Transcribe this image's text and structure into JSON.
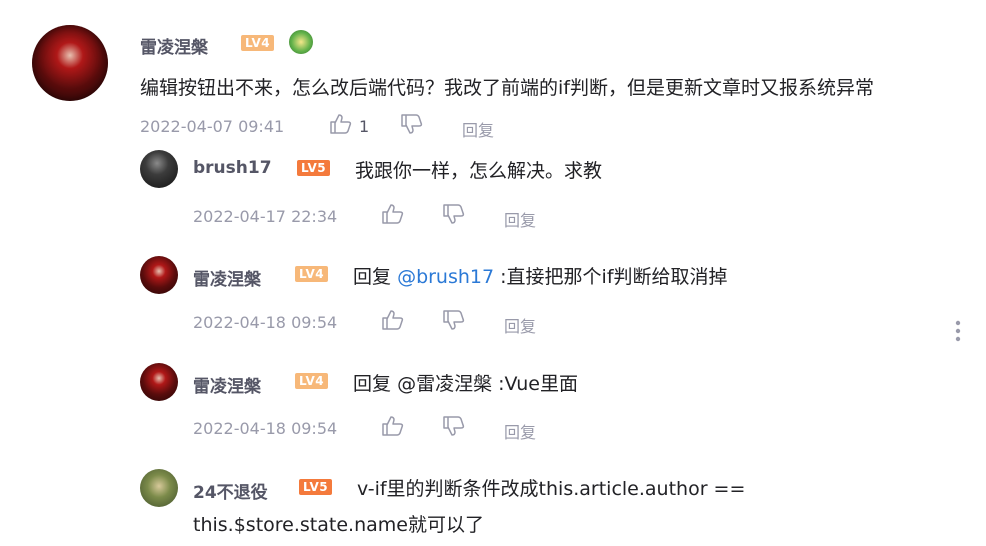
{
  "comments": [
    {
      "user": "雷凌涅槃",
      "level": "LV4",
      "text": "编辑按钮出不来，怎么改后端代码？我改了前端的if判断，但是更新文章时又报系统异常",
      "time": "2022-04-07 09:41",
      "likes": "1",
      "reply_label": "回复"
    }
  ],
  "replies": [
    {
      "user": "brush17",
      "level": "LV5",
      "text": "我跟你一样，怎么解决。求教",
      "time": "2022-04-17 22:34",
      "reply_label": "回复"
    },
    {
      "user": "雷凌涅槃",
      "level": "LV4",
      "reply_prefix": "回复",
      "mention": "@brush17",
      "text": ":直接把那个if判断给取消掉",
      "time": "2022-04-18 09:54",
      "reply_label": "回复"
    },
    {
      "user": "雷凌涅槃",
      "level": "LV4",
      "reply_prefix": "回复",
      "mention": "@雷凌涅槃",
      "text": ":Vue里面",
      "time": "2022-04-18 09:54",
      "reply_label": "回复"
    },
    {
      "user": "24不退役",
      "level": "LV5",
      "text": "v-if里的判断条件改成this.article.author ==",
      "text_line2": "this.$store.state.name就可以了"
    }
  ],
  "icons": {
    "like": "thumbs-up-icon",
    "dislike": "thumbs-down-icon",
    "more": "more-vertical-icon",
    "badge": "achievement-badge-icon"
  },
  "colors": {
    "lv4": "#f7b879",
    "lv5": "#f47a3c",
    "mention": "#2b79d6",
    "meta": "#999aaa"
  }
}
